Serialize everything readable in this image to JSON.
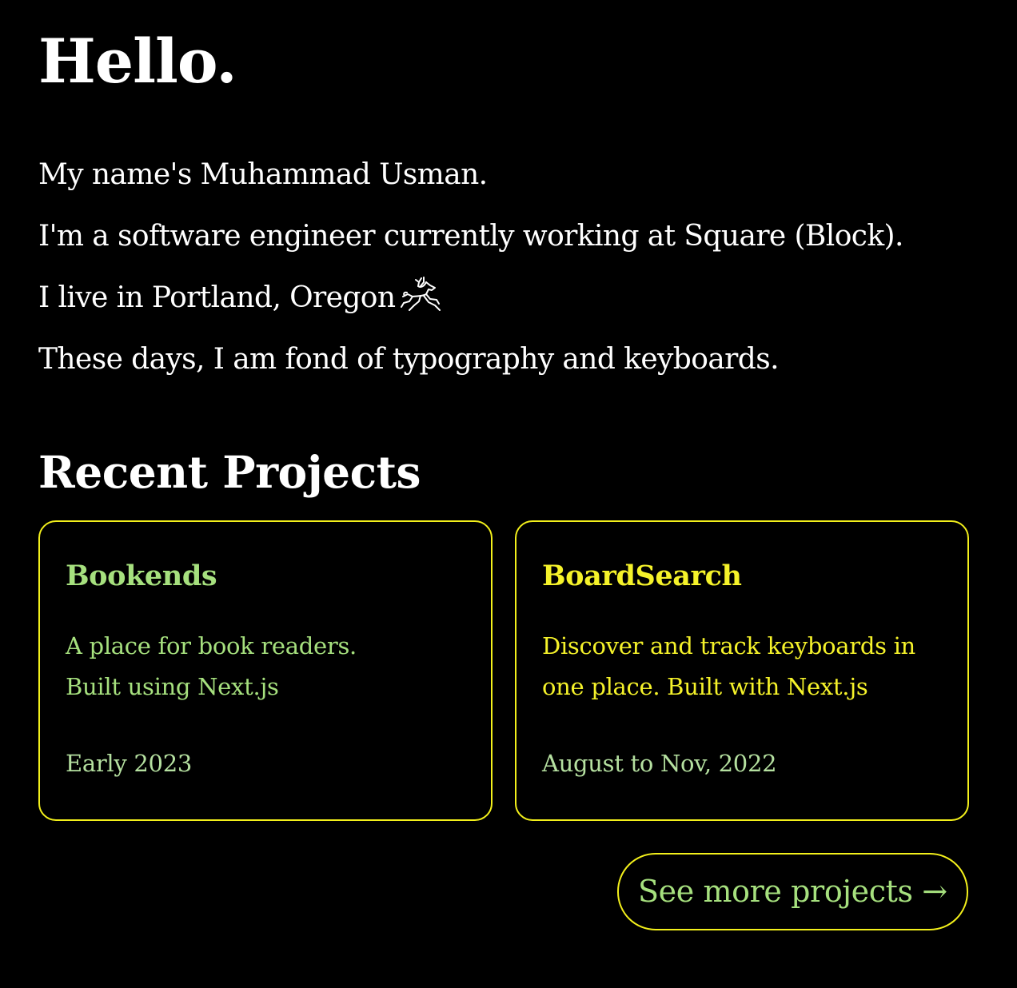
{
  "greeting": "Hello.",
  "intro": {
    "line1": "My name's Muhammad Usman.",
    "line2": "I'm a software engineer currently working at Square (Block).",
    "line3": "I live in Portland, Oregon",
    "line3_icon": "deer-icon",
    "line4": "These days, I am fond of typography and keyboards."
  },
  "projects": {
    "heading": "Recent Projects",
    "items": [
      {
        "title": "Bookends",
        "desc_line1": "A place for book readers.",
        "desc_line2": "Built using Next.js",
        "date": "Early 2023",
        "accent": "#a6e07e"
      },
      {
        "title": "BoardSearch",
        "desc_line1": "Discover and track keyboards in",
        "desc_line2": "one place. Built with Next.js",
        "date": "August to Nov, 2022",
        "accent": "#f5f22a"
      }
    ],
    "see_more_label": "See more projects →"
  },
  "colors": {
    "background": "#000000",
    "text": "#ffffff",
    "border": "#f3f01b",
    "green": "#a6e07e",
    "yellow": "#f5f22a",
    "date": "#b5e0a0"
  }
}
